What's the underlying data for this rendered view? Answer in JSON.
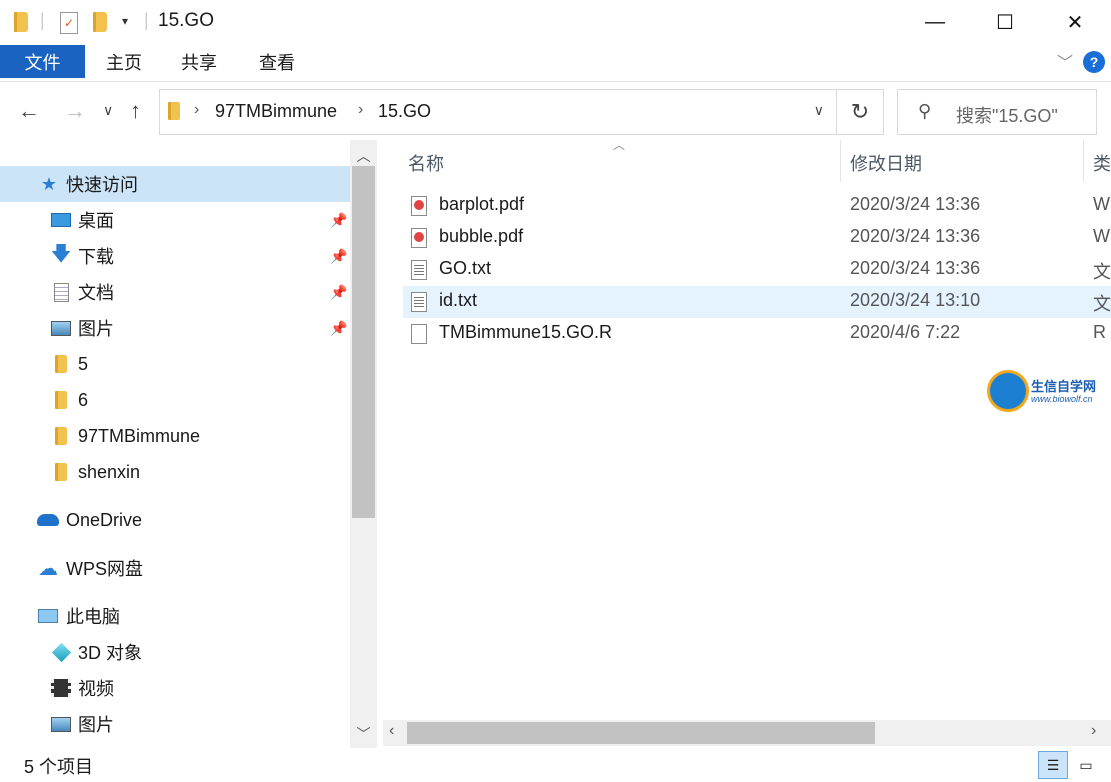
{
  "window": {
    "title": "15.GO",
    "minimize": "—",
    "maximize": "☐",
    "close": "✕"
  },
  "ribbon": {
    "tabs": [
      "文件",
      "主页",
      "共享",
      "查看"
    ],
    "help": "?"
  },
  "address": {
    "crumbs": [
      "97TMBimmune",
      "15.GO"
    ],
    "search_placeholder": "搜索\"15.GO\""
  },
  "nav": {
    "items": [
      {
        "label": "快速访问",
        "icon": "star-icon",
        "pinned": false
      },
      {
        "label": "桌面",
        "icon": "desktop-icon",
        "pinned": true
      },
      {
        "label": "下载",
        "icon": "download-icon",
        "pinned": true
      },
      {
        "label": "文档",
        "icon": "document-icon",
        "pinned": true
      },
      {
        "label": "图片",
        "icon": "pictures-icon",
        "pinned": true
      },
      {
        "label": "5",
        "icon": "folder-icon",
        "pinned": false
      },
      {
        "label": "6",
        "icon": "folder-icon",
        "pinned": false
      },
      {
        "label": "97TMBimmune",
        "icon": "folder-icon",
        "pinned": false
      },
      {
        "label": "shenxin",
        "icon": "folder-icon",
        "pinned": false
      },
      {
        "label": "OneDrive",
        "icon": "onedrive-icon",
        "pinned": false
      },
      {
        "label": "WPS网盘",
        "icon": "wps-cloud-icon",
        "pinned": false
      },
      {
        "label": "此电脑",
        "icon": "computer-icon",
        "pinned": false
      },
      {
        "label": "3D 对象",
        "icon": "3d-objects-icon",
        "pinned": false
      },
      {
        "label": "视频",
        "icon": "video-icon",
        "pinned": false
      },
      {
        "label": "图片",
        "icon": "pictures-icon",
        "pinned": false
      }
    ]
  },
  "columns": {
    "name": "名称",
    "modified": "修改日期",
    "type": "类"
  },
  "files": [
    {
      "name": "barplot.pdf",
      "date": "2020/3/24 13:36",
      "type": "W",
      "icon": "pdf"
    },
    {
      "name": "bubble.pdf",
      "date": "2020/3/24 13:36",
      "type": "W",
      "icon": "pdf"
    },
    {
      "name": "GO.txt",
      "date": "2020/3/24 13:36",
      "type": "文",
      "icon": "txt"
    },
    {
      "name": "id.txt",
      "date": "2020/3/24 13:10",
      "type": "文",
      "icon": "txt"
    },
    {
      "name": "TMBimmune15.GO.R",
      "date": "2020/4/6 7:22",
      "type": "R",
      "icon": "blank"
    }
  ],
  "watermark": {
    "title": "生信自学网",
    "url": "www.biowolf.cn"
  },
  "status": {
    "count": "5 个项目"
  }
}
